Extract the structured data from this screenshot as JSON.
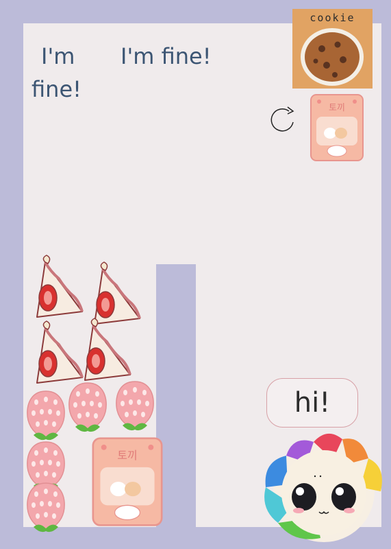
{
  "scene": {
    "background_color": "#bcbbd9",
    "board_color": "#f0ebec"
  },
  "texts": {
    "im_fine_left_line1": "I'm",
    "im_fine_left_line2": "fine!",
    "im_fine_right": "I'm fine!",
    "cookie_label": "cookie",
    "hi_bubble": "hi!"
  },
  "snack_label": "토끼",
  "stickers": [
    {
      "name": "cookie-card",
      "icon": "cookie-icon"
    },
    {
      "name": "rotate-arrow",
      "icon": "rotate-icon"
    },
    {
      "name": "bunny-snack-bag-small",
      "icon": "bunny-snack-bag-icon"
    },
    {
      "name": "bunny-snack-bag-large",
      "icon": "bunny-snack-bag-icon"
    },
    {
      "name": "strawberry-sandwich",
      "icon": "strawberry-sandwich-icon",
      "count": 4
    },
    {
      "name": "strawberry",
      "icon": "strawberry-icon",
      "count": 5
    },
    {
      "name": "rainbow-cat-mascot",
      "icon": "rainbow-cat-icon"
    }
  ]
}
